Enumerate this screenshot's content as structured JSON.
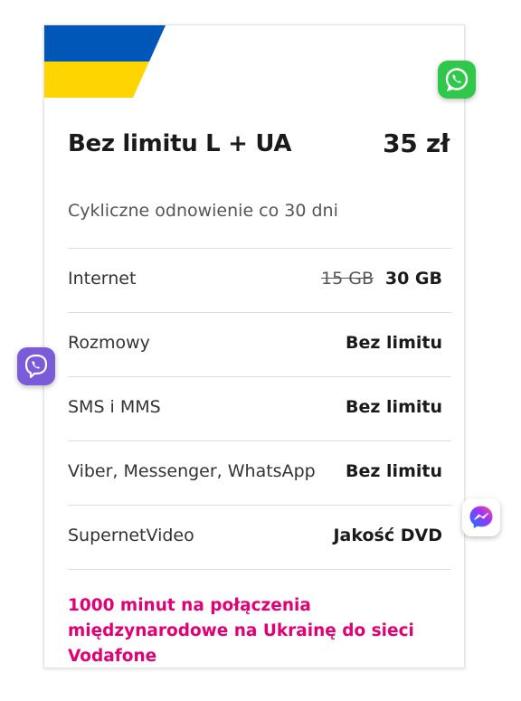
{
  "card": {
    "title": "Bez limitu L + UA",
    "price": "35 zł",
    "renewal": "Cykliczne  odnowienie co 30 dni",
    "rows": [
      {
        "label": "Internet",
        "old_value": "15 GB",
        "value": "30 GB"
      },
      {
        "label": "Rozmowy",
        "value": "Bez limitu"
      },
      {
        "label": "SMS i MMS",
        "value": "Bez limitu"
      },
      {
        "label": "Viber, Messenger, WhatsApp",
        "value": "Bez limitu"
      },
      {
        "label": "SupernetVideo",
        "value": "Jakość DVD"
      }
    ],
    "promo": "1000 minut na połączenia międzynarodowe na Ukrainę do sieci Vodafone"
  },
  "flag": {
    "colors": {
      "top": "#0057b7",
      "bottom": "#ffd500"
    }
  },
  "app_icons": {
    "whatsapp": {
      "name": "whatsapp-icon",
      "color": "#2fc84a"
    },
    "viber": {
      "name": "viber-icon",
      "color": "#7a5bd8"
    },
    "messenger": {
      "name": "messenger-icon",
      "color": "#ffffff"
    }
  },
  "colors": {
    "accent": "#e20074",
    "text": "#1a1a1a"
  }
}
